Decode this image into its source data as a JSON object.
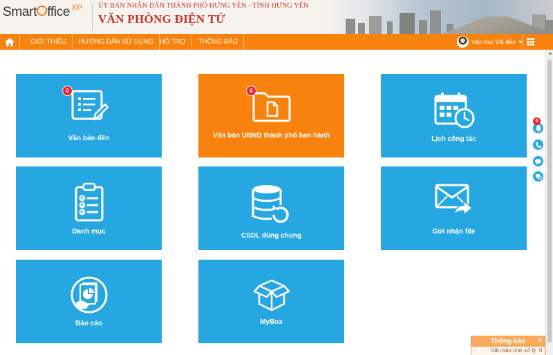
{
  "header": {
    "logo_smart": "Smart",
    "logo_office": "ffice",
    "logo_xp": "XP",
    "org_name": "ỦY BAN NHÂN DÂN THÀNH PHỐ HƯNG YÊN - TỈNH HƯNG YÊN",
    "office_name": "VĂN PHÒNG ĐIỆN TỬ"
  },
  "nav": {
    "home_icon": "home-icon",
    "items": [
      {
        "label": "GIỚI THIỆU"
      },
      {
        "label": "HƯỚNG DẪN SỬ DỤNG"
      },
      {
        "label": "HỖ TRỢ"
      },
      {
        "label": "THÔNG BÁO"
      }
    ],
    "user_name": "Văn thư VB đến",
    "apps_icon": "grid-icon"
  },
  "tiles": [
    {
      "label": "Văn bản đến",
      "badge": "0",
      "icon": "document-edit-icon",
      "color": "#27a7e1"
    },
    {
      "label": "Văn bản UBND thành phố ban hành",
      "badge": "0",
      "icon": "folder-document-icon",
      "color": "#f7820e"
    },
    {
      "label": "Lịch công tác",
      "icon": "calendar-clock-icon",
      "color": "#27a7e1"
    },
    {
      "label": "Danh mục",
      "icon": "clipboard-checklist-icon",
      "color": "#27a7e1"
    },
    {
      "label": "CSDL dùng chung",
      "icon": "database-refresh-icon",
      "color": "#27a7e1"
    },
    {
      "label": "Gửi nhận file",
      "icon": "mail-forward-icon",
      "color": "#27a7e1"
    },
    {
      "label": "Báo cáo",
      "icon": "report-chart-icon",
      "color": "#27a7e1"
    },
    {
      "label": "MyBox",
      "icon": "box-icon",
      "color": "#27a7e1"
    }
  ],
  "side": {
    "bell_badge": "0"
  },
  "notification": {
    "title": "Thông báo",
    "body": "Văn bản chờ xử lý",
    "count": "0"
  }
}
